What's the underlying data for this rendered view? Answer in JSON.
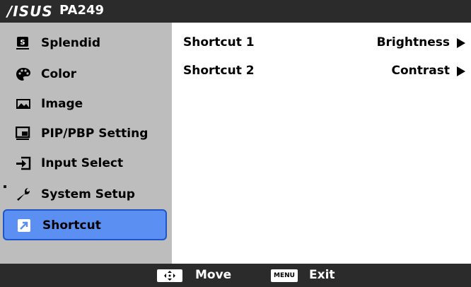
{
  "header": {
    "brand": "/ISUS",
    "model": "PA249"
  },
  "sidebar": {
    "items": [
      {
        "label": "Splendid",
        "icon": "splendid-icon"
      },
      {
        "label": "Color",
        "icon": "palette-icon"
      },
      {
        "label": "Image",
        "icon": "image-icon"
      },
      {
        "label": "PIP/PBP Setting",
        "icon": "pip-icon"
      },
      {
        "label": "Input Select",
        "icon": "input-select-icon"
      },
      {
        "label": "System Setup",
        "icon": "wrench-icon"
      },
      {
        "label": "Shortcut",
        "icon": "shortcut-icon"
      }
    ],
    "selected": "Shortcut"
  },
  "main": {
    "rows": [
      {
        "label": "Shortcut 1",
        "value": "Brightness"
      },
      {
        "label": "Shortcut 2",
        "value": "Contrast"
      }
    ]
  },
  "footer": {
    "move_icon_text": "◆",
    "move_label": "Move",
    "exit_icon_text": "MENU",
    "exit_label": "Exit"
  },
  "colors": {
    "selected_bg": "#5b8ff2",
    "selected_border": "#1e55c8",
    "sidebar_bg": "#bdbdbd",
    "bar_bg": "#2b2b2b"
  }
}
